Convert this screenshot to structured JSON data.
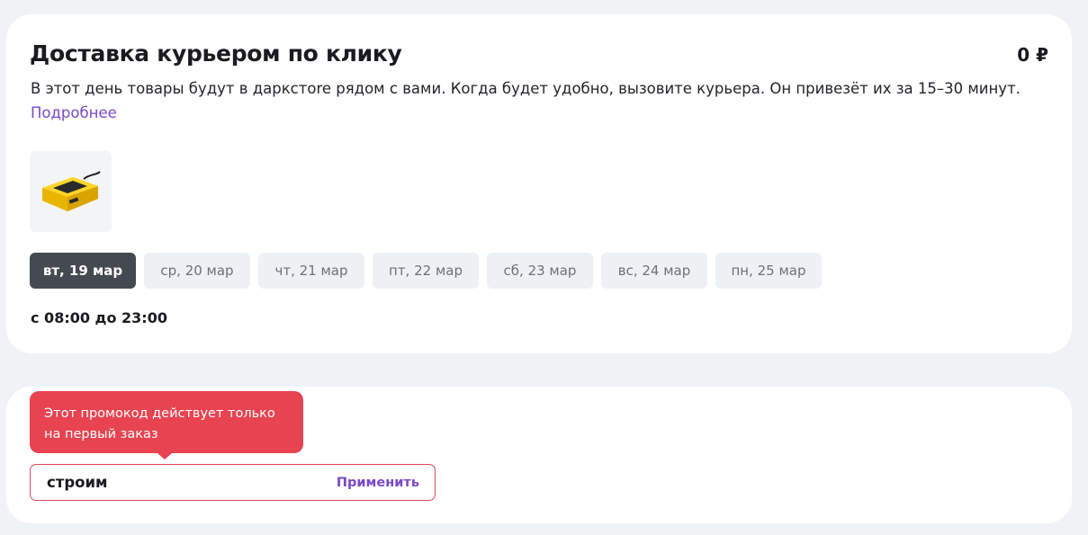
{
  "delivery": {
    "title": "Доставка курьером по клику",
    "price": "0 ₽",
    "description": "В этот день товары будут в даркстore рядом с вами. Когда будет удобно, вызовите курьера. Он привезёт их за 15–30 минут.",
    "more_link": "Подробнее",
    "product_image": "battery-charger",
    "dates": [
      {
        "label": "вт, 19 мар",
        "selected": true
      },
      {
        "label": "ср, 20 мар",
        "selected": false
      },
      {
        "label": "чт, 21 мар",
        "selected": false
      },
      {
        "label": "пт, 22 мар",
        "selected": false
      },
      {
        "label": "сб, 23 мар",
        "selected": false
      },
      {
        "label": "вс, 24 мар",
        "selected": false
      },
      {
        "label": "пн, 25 мар",
        "selected": false
      }
    ],
    "hours": "с 08:00 до 23:00"
  },
  "promo": {
    "tooltip_line1": "Этот промокод действует только",
    "tooltip_line2": "на первый заказ",
    "input_value": "строим",
    "apply_label": "Применить"
  },
  "colors": {
    "accent": "#7a48c8",
    "error": "#e84350",
    "selected_chip": "#454a50",
    "background": "#f0f3f6"
  }
}
